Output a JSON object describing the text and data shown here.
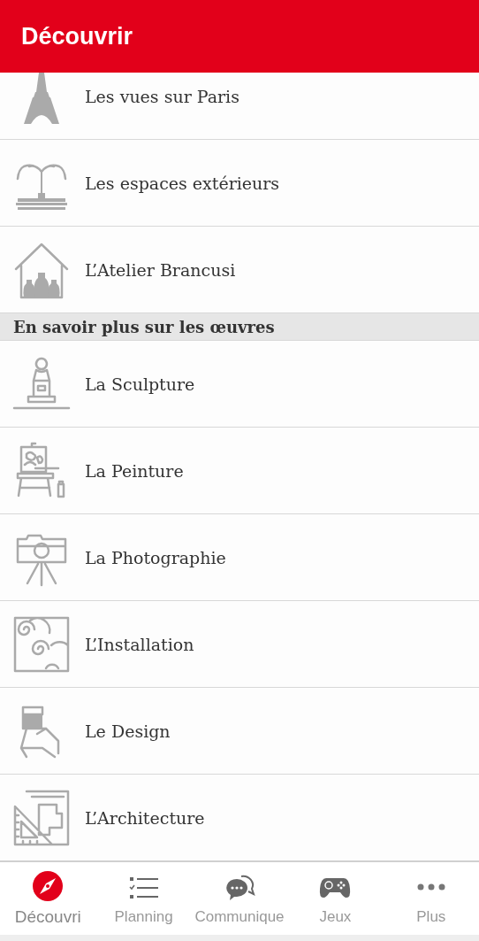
{
  "header": {
    "title": "Découvrir"
  },
  "list": [
    {
      "kind": "item",
      "label": "Les vues sur Paris"
    },
    {
      "kind": "item",
      "label": "Les espaces extérieurs"
    },
    {
      "kind": "item",
      "label": "L’Atelier Brancusi"
    },
    {
      "kind": "section",
      "label": "En savoir plus sur les œuvres"
    },
    {
      "kind": "item",
      "label": "La Sculpture"
    },
    {
      "kind": "item",
      "label": "La Peinture"
    },
    {
      "kind": "item",
      "label": "La Photographie"
    },
    {
      "kind": "item",
      "label": "L’Installation"
    },
    {
      "kind": "item",
      "label": "Le Design"
    },
    {
      "kind": "item",
      "label": "L’Architecture"
    }
  ],
  "tabs": [
    {
      "label": "Découvri",
      "selected": true
    },
    {
      "label": "Planning",
      "selected": false
    },
    {
      "label": "Communique",
      "selected": false
    },
    {
      "label": "Jeux",
      "selected": false
    },
    {
      "label": "Plus",
      "selected": false
    }
  ]
}
